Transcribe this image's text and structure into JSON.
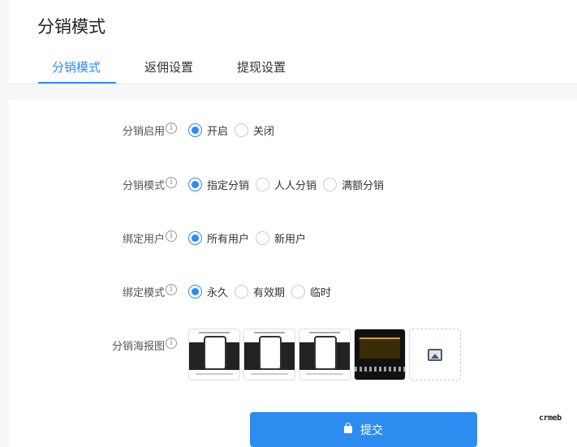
{
  "page_title": "分销模式",
  "tabs": [
    {
      "label": "分销模式",
      "active": true
    },
    {
      "label": "返佣设置",
      "active": false
    },
    {
      "label": "提现设置",
      "active": false
    }
  ],
  "form": {
    "enable": {
      "label": "分销启用",
      "options": [
        "开启",
        "关闭"
      ],
      "selected": "开启"
    },
    "mode": {
      "label": "分销模式",
      "options": [
        "指定分销",
        "人人分销",
        "满额分销"
      ],
      "selected": "指定分销"
    },
    "bind_user": {
      "label": "绑定用户",
      "options": [
        "所有用户",
        "新用户"
      ],
      "selected": "所有用户"
    },
    "bind_mode": {
      "label": "绑定模式",
      "options": [
        "永久",
        "有效期",
        "临时"
      ],
      "selected": "永久"
    },
    "poster": {
      "label": "分销海报图",
      "count": 4
    }
  },
  "submit_label": "提交",
  "logo_text": "crmeb",
  "colors": {
    "accent": "#2d8cf0"
  }
}
